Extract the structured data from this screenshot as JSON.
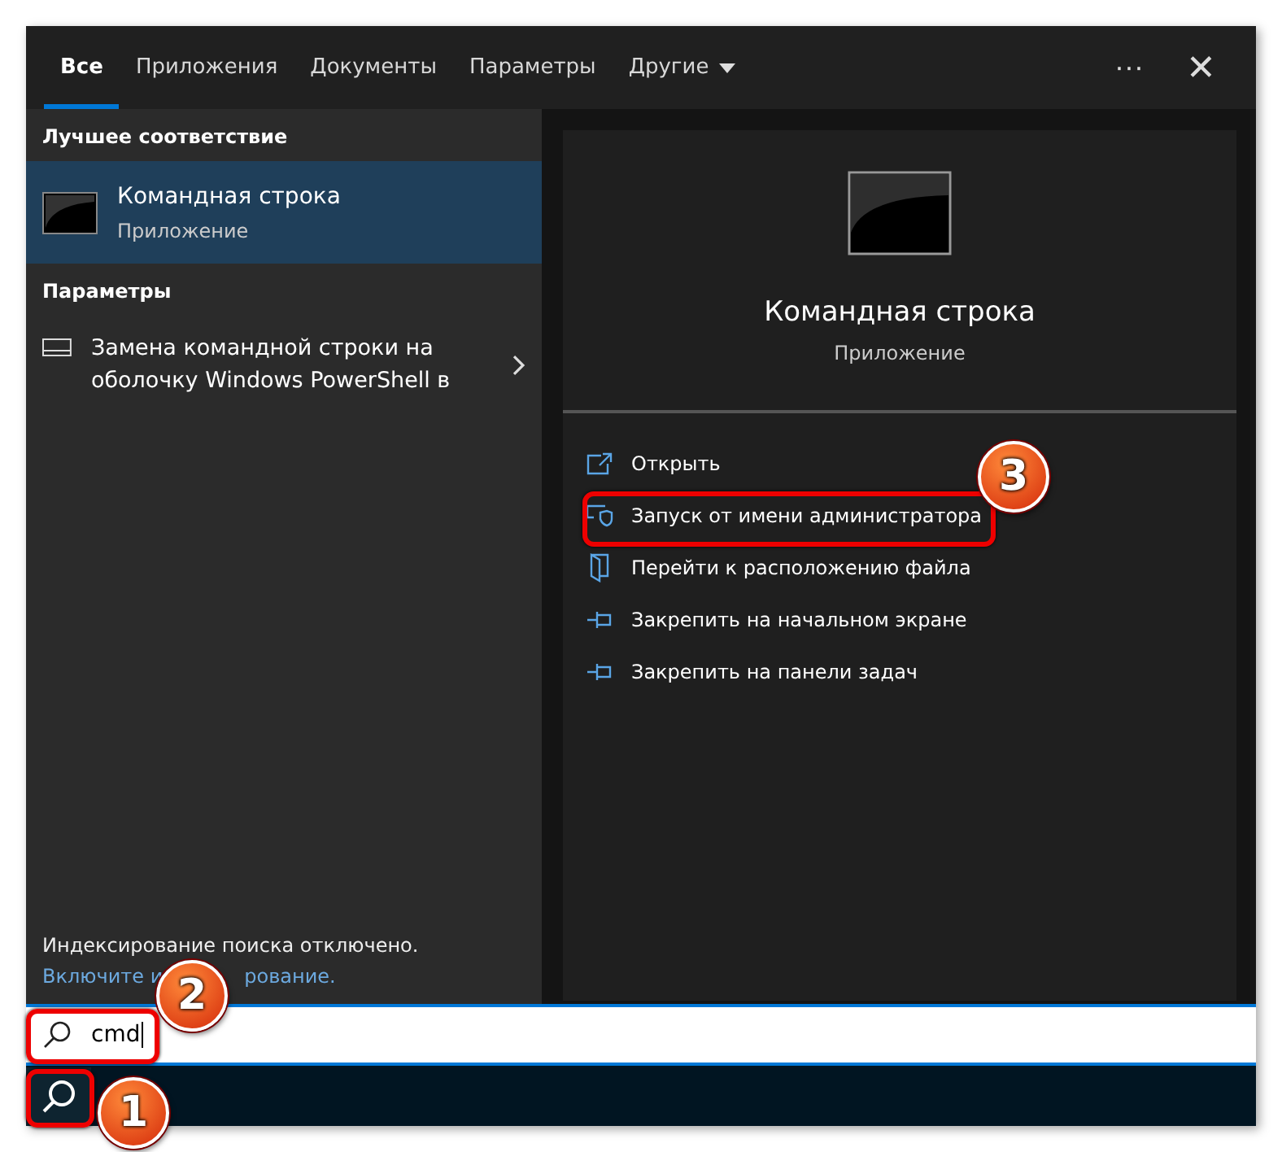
{
  "tabs": [
    {
      "label": "Все",
      "selected": true
    },
    {
      "label": "Приложения",
      "selected": false
    },
    {
      "label": "Документы",
      "selected": false
    },
    {
      "label": "Параметры",
      "selected": false
    },
    {
      "label": "Другие",
      "selected": false,
      "kind": "dropdown"
    }
  ],
  "header_buttons": {
    "more": "···",
    "close": "✕"
  },
  "results": [
    {
      "heading": "Лучшее соответствие",
      "items": [
        {
          "kind": "app",
          "title": "Командная строка",
          "subtitle": "Приложение",
          "selected": true
        }
      ]
    },
    {
      "heading": "Параметры",
      "items": [
        {
          "kind": "setting",
          "title": "Замена командной строки на оболочку Windows PowerShell в",
          "selected": false
        }
      ]
    }
  ],
  "indexing": {
    "message": "Индексирование поиска отключено.",
    "link_parts": [
      "Включите и",
      "рование."
    ]
  },
  "preview": {
    "title": "Командная строка",
    "subtitle": "Приложение",
    "actions": [
      {
        "kind": "open",
        "label": "Открыть"
      },
      {
        "kind": "admin",
        "label": "Запуск от имени администратора"
      },
      {
        "kind": "folder",
        "label": "Перейти к расположению файла"
      },
      {
        "kind": "pin",
        "label": "Закрепить на начальном экране"
      },
      {
        "kind": "pin",
        "label": "Закрепить на панели задач"
      }
    ]
  },
  "search": {
    "value": "cmd"
  },
  "callouts": [
    {
      "number": "1"
    },
    {
      "number": "2"
    },
    {
      "number": "3"
    }
  ]
}
